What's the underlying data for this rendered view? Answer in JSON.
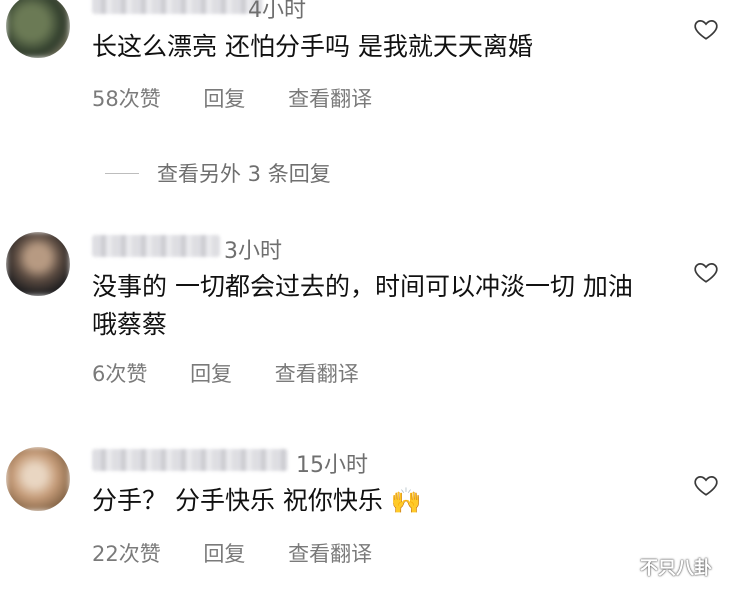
{
  "comments": [
    {
      "time": "4小时",
      "text": "长这么漂亮 还怕分手吗 是我就天天离婚",
      "likes": "58次赞",
      "reply": "回复",
      "translate": "查看翻译",
      "avatar_colors": [
        "#2d3a2a",
        "#6b7a55",
        "#c9b69a"
      ]
    },
    {
      "time": "3小时",
      "text": "没事的 一切都会过去的，时间可以冲淡一切 加油哦蔡蔡",
      "likes": "6次赞",
      "reply": "回复",
      "translate": "查看翻译",
      "avatar_colors": [
        "#1d1d1f",
        "#5a4a40",
        "#b79a82"
      ]
    },
    {
      "time": "15小时",
      "text": "分手？ 分手快乐 祝你快乐 🙌",
      "likes": "22次赞",
      "reply": "回复",
      "translate": "查看翻译",
      "avatar_colors": [
        "#7a5c3f",
        "#c59b78",
        "#e9d6c2"
      ]
    }
  ],
  "more_replies": "查看另外 3 条回复",
  "watermark": "不只八卦",
  "colors": {
    "text": "#111111",
    "secondary": "#7a7a7a",
    "time": "#6f6f6f",
    "heart": "#3a3a3a"
  }
}
